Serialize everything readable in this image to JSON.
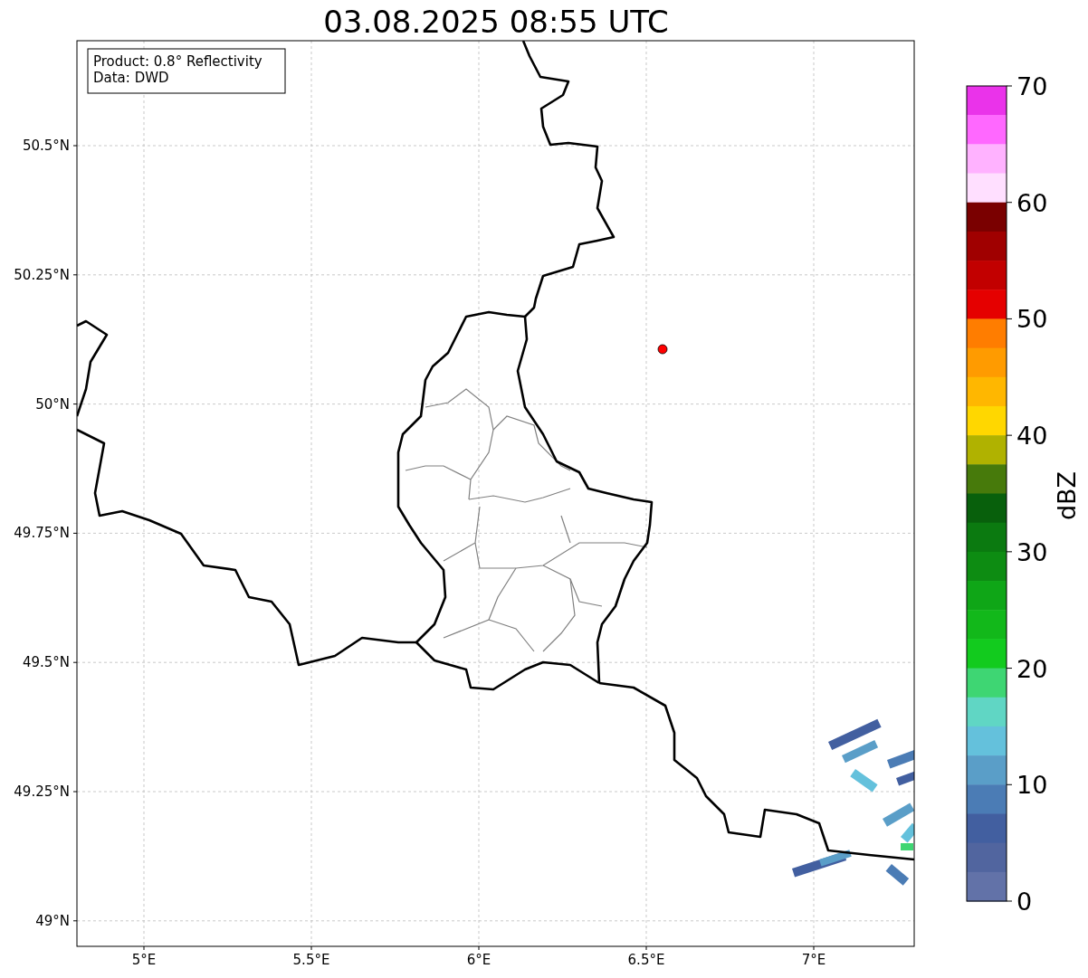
{
  "title": "03.08.2025 08:55 UTC",
  "info_box": {
    "lines": [
      "Product: 0.8° Reflectivity",
      "Data: DWD"
    ]
  },
  "map": {
    "lon_ticks": [
      "5°E",
      "5.5°E",
      "6°E",
      "6.5°E",
      "7°E"
    ],
    "lat_ticks": [
      "50.5°N",
      "50.25°N",
      "50°N",
      "49.75°N",
      "49.5°N",
      "49.25°N",
      "49°N"
    ]
  },
  "colorbar": {
    "label": "dBZ",
    "ticks": [
      "70",
      "60",
      "50",
      "40",
      "30",
      "20",
      "10",
      "0"
    ],
    "bins": [
      {
        "color": "#ea33ea"
      },
      {
        "color": "#ff68ff"
      },
      {
        "color": "#ffb2ff"
      },
      {
        "color": "#ffdfff"
      },
      {
        "color": "#7a0000"
      },
      {
        "color": "#a00000"
      },
      {
        "color": "#c20000"
      },
      {
        "color": "#e50000"
      },
      {
        "color": "#ff7d00"
      },
      {
        "color": "#ff9b00"
      },
      {
        "color": "#ffb700"
      },
      {
        "color": "#ffd700"
      },
      {
        "color": "#b0b200"
      },
      {
        "color": "#477a0b"
      },
      {
        "color": "#08600c"
      },
      {
        "color": "#0b7a10"
      },
      {
        "color": "#0d8c12"
      },
      {
        "color": "#0fa617"
      },
      {
        "color": "#12b81a"
      },
      {
        "color": "#12cb1e"
      },
      {
        "color": "#3ed673"
      },
      {
        "color": "#60d6c4"
      },
      {
        "color": "#64c1dc"
      },
      {
        "color": "#5a9ec8"
      },
      {
        "color": "#4b7cb5"
      },
      {
        "color": "#425fa0"
      },
      {
        "color": "#51659f"
      },
      {
        "color": "#6272a8"
      }
    ]
  }
}
